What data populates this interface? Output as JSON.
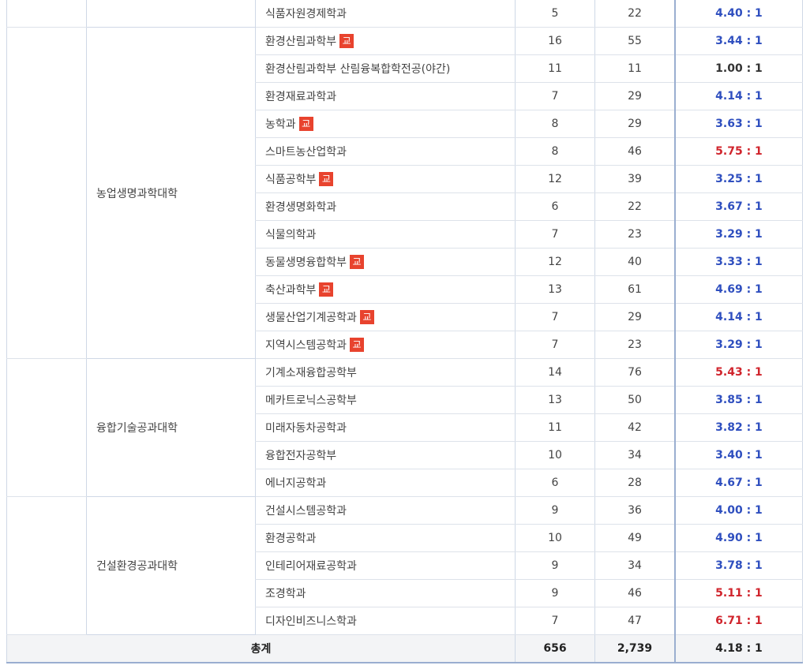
{
  "badge_label": "교",
  "colors": {
    "blue": "#2f4fbf",
    "red": "#d0242c",
    "badge": "#e8432e"
  },
  "groups": [
    {
      "college": "",
      "rows": [
        {
          "dept": "식품자원경제학과",
          "badge": false,
          "quota": "5",
          "applicants": "22",
          "ratio": "4.40 : 1",
          "color": "blue"
        }
      ]
    },
    {
      "college": "농업생명과학대학",
      "rows": [
        {
          "dept": "환경산림과학부",
          "badge": true,
          "quota": "16",
          "applicants": "55",
          "ratio": "3.44 : 1",
          "color": "blue"
        },
        {
          "dept": "환경산림과학부 산림융복합학전공(야간)",
          "badge": false,
          "quota": "11",
          "applicants": "11",
          "ratio": "1.00 : 1",
          "color": "dark"
        },
        {
          "dept": "환경재료과학과",
          "badge": false,
          "quota": "7",
          "applicants": "29",
          "ratio": "4.14 : 1",
          "color": "blue"
        },
        {
          "dept": "농학과",
          "badge": true,
          "quota": "8",
          "applicants": "29",
          "ratio": "3.63 : 1",
          "color": "blue"
        },
        {
          "dept": "스마트농산업학과",
          "badge": false,
          "quota": "8",
          "applicants": "46",
          "ratio": "5.75 : 1",
          "color": "red"
        },
        {
          "dept": "식품공학부",
          "badge": true,
          "quota": "12",
          "applicants": "39",
          "ratio": "3.25 : 1",
          "color": "blue"
        },
        {
          "dept": "환경생명화학과",
          "badge": false,
          "quota": "6",
          "applicants": "22",
          "ratio": "3.67 : 1",
          "color": "blue"
        },
        {
          "dept": "식물의학과",
          "badge": false,
          "quota": "7",
          "applicants": "23",
          "ratio": "3.29 : 1",
          "color": "blue"
        },
        {
          "dept": "동물생명융합학부",
          "badge": true,
          "quota": "12",
          "applicants": "40",
          "ratio": "3.33 : 1",
          "color": "blue"
        },
        {
          "dept": "축산과학부",
          "badge": true,
          "quota": "13",
          "applicants": "61",
          "ratio": "4.69 : 1",
          "color": "blue"
        },
        {
          "dept": "생물산업기계공학과",
          "badge": true,
          "quota": "7",
          "applicants": "29",
          "ratio": "4.14 : 1",
          "color": "blue"
        },
        {
          "dept": "지역시스템공학과",
          "badge": true,
          "quota": "7",
          "applicants": "23",
          "ratio": "3.29 : 1",
          "color": "blue"
        }
      ]
    },
    {
      "college": "융합기술공과대학",
      "rows": [
        {
          "dept": "기계소재융합공학부",
          "badge": false,
          "quota": "14",
          "applicants": "76",
          "ratio": "5.43 : 1",
          "color": "red"
        },
        {
          "dept": "메카트로닉스공학부",
          "badge": false,
          "quota": "13",
          "applicants": "50",
          "ratio": "3.85 : 1",
          "color": "blue"
        },
        {
          "dept": "미래자동차공학과",
          "badge": false,
          "quota": "11",
          "applicants": "42",
          "ratio": "3.82 : 1",
          "color": "blue"
        },
        {
          "dept": "융합전자공학부",
          "badge": false,
          "quota": "10",
          "applicants": "34",
          "ratio": "3.40 : 1",
          "color": "blue"
        },
        {
          "dept": "에너지공학과",
          "badge": false,
          "quota": "6",
          "applicants": "28",
          "ratio": "4.67 : 1",
          "color": "blue"
        }
      ]
    },
    {
      "college": "건설환경공과대학",
      "rows": [
        {
          "dept": "건설시스템공학과",
          "badge": false,
          "quota": "9",
          "applicants": "36",
          "ratio": "4.00 : 1",
          "color": "blue"
        },
        {
          "dept": "환경공학과",
          "badge": false,
          "quota": "10",
          "applicants": "49",
          "ratio": "4.90 : 1",
          "color": "blue"
        },
        {
          "dept": "인테리어재료공학과",
          "badge": false,
          "quota": "9",
          "applicants": "34",
          "ratio": "3.78 : 1",
          "color": "blue"
        },
        {
          "dept": "조경학과",
          "badge": false,
          "quota": "9",
          "applicants": "46",
          "ratio": "5.11 : 1",
          "color": "red"
        },
        {
          "dept": "디자인비즈니스학과",
          "badge": false,
          "quota": "7",
          "applicants": "47",
          "ratio": "6.71 : 1",
          "color": "red"
        }
      ]
    }
  ],
  "total": {
    "label": "총계",
    "quota": "656",
    "applicants": "2,739",
    "ratio": "4.18 : 1"
  }
}
